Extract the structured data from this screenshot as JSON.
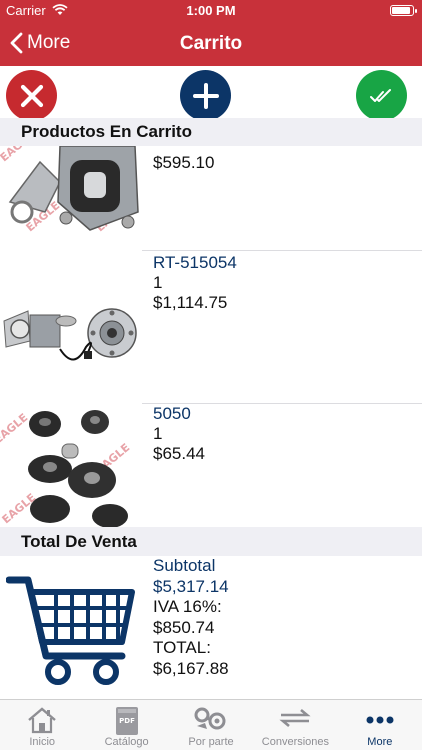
{
  "status_bar": {
    "carrier": "Carrier",
    "time": "1:00 PM",
    "battery_level": 0.95
  },
  "nav": {
    "back_label": "More",
    "title": "Carrito"
  },
  "actions": {
    "cancel_icon": "close-icon",
    "add_icon": "plus-icon",
    "confirm_icon": "double-check-icon"
  },
  "colors": {
    "brand_red": "#c8313a",
    "navy": "#0c3567",
    "cancel_red": "#c62a2f",
    "confirm_green": "#18a545"
  },
  "cart": {
    "header": "Productos En Carrito",
    "items": [
      {
        "code": "",
        "quantity": "",
        "price": "$595.10",
        "image": "engine-mount-image"
      },
      {
        "code": "RT-515054",
        "quantity": "1",
        "price": "$1,114.75",
        "image": "wheel-hub-image"
      },
      {
        "code": "5050",
        "quantity": "1",
        "price": "$65.44",
        "image": "rubber-bushings-image"
      }
    ]
  },
  "totals": {
    "header": "Total De Venta",
    "subtotal_label": "Subtotal",
    "subtotal_value": "$5,317.14",
    "iva_label": "IVA 16%:",
    "iva_value": "$850.74",
    "total_label": "TOTAL:",
    "total_value": "$6,167.88"
  },
  "tabs": [
    {
      "label": "Inicio",
      "icon": "home-icon",
      "active": false
    },
    {
      "label": "Catálogo",
      "icon": "pdf-book-icon",
      "active": false
    },
    {
      "label": "Por parte",
      "icon": "parts-icon",
      "active": false
    },
    {
      "label": "Conversiones",
      "icon": "conversion-icon",
      "active": false
    },
    {
      "label": "More",
      "icon": "more-dots-icon",
      "active": true
    }
  ]
}
